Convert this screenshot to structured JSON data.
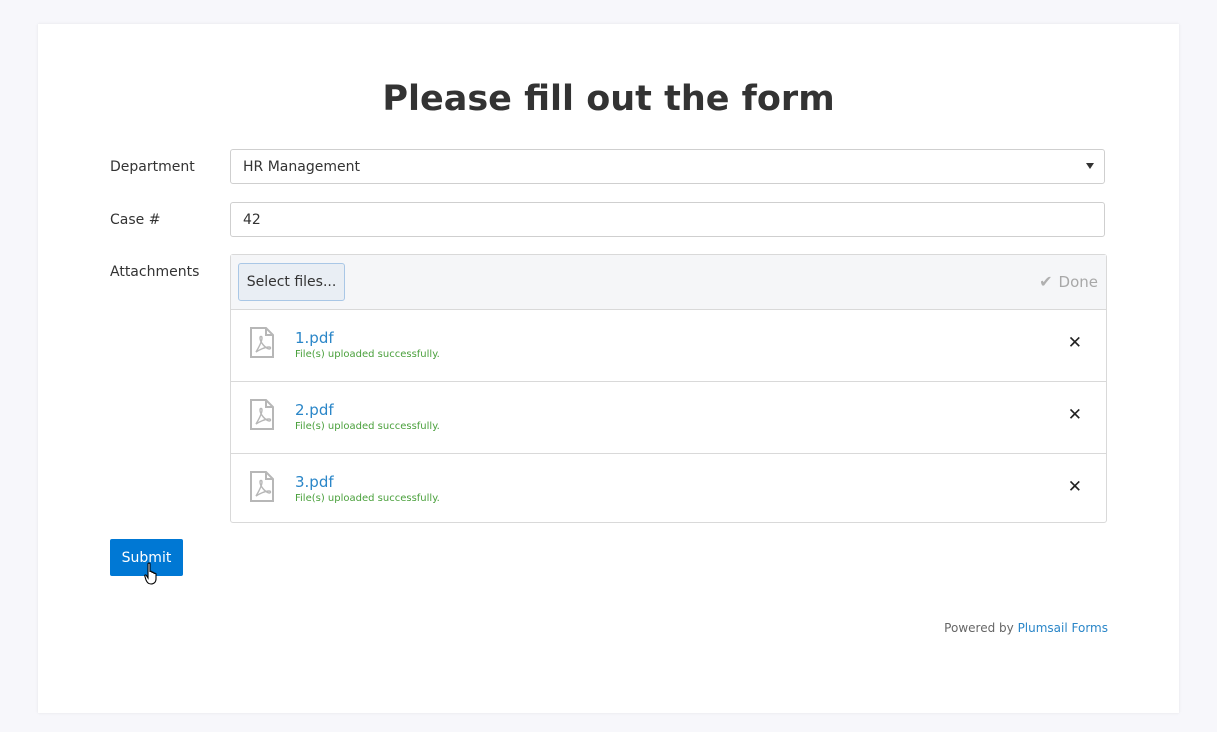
{
  "form": {
    "title": "Please fill out the form",
    "department": {
      "label": "Department",
      "value": "HR Management"
    },
    "case": {
      "label": "Case #",
      "value": "42"
    },
    "attachments": {
      "label": "Attachments",
      "select_files_label": "Select files...",
      "done_label": "Done",
      "files": [
        {
          "name": "1.pdf",
          "status": "File(s) uploaded successfully."
        },
        {
          "name": "2.pdf",
          "status": "File(s) uploaded successfully."
        },
        {
          "name": "3.pdf",
          "status": "File(s) uploaded successfully."
        }
      ]
    },
    "submit_label": "Submit"
  },
  "footer": {
    "powered_by": "Powered by",
    "brand_link": "Plumsail Forms"
  },
  "colors": {
    "accent": "#0078d4",
    "link": "#2a86c8",
    "success": "#4aa03c"
  },
  "icons": {
    "file": "pdf-file-icon",
    "remove": "close-icon",
    "done": "check-icon",
    "dropdown": "chevron-down-icon"
  }
}
